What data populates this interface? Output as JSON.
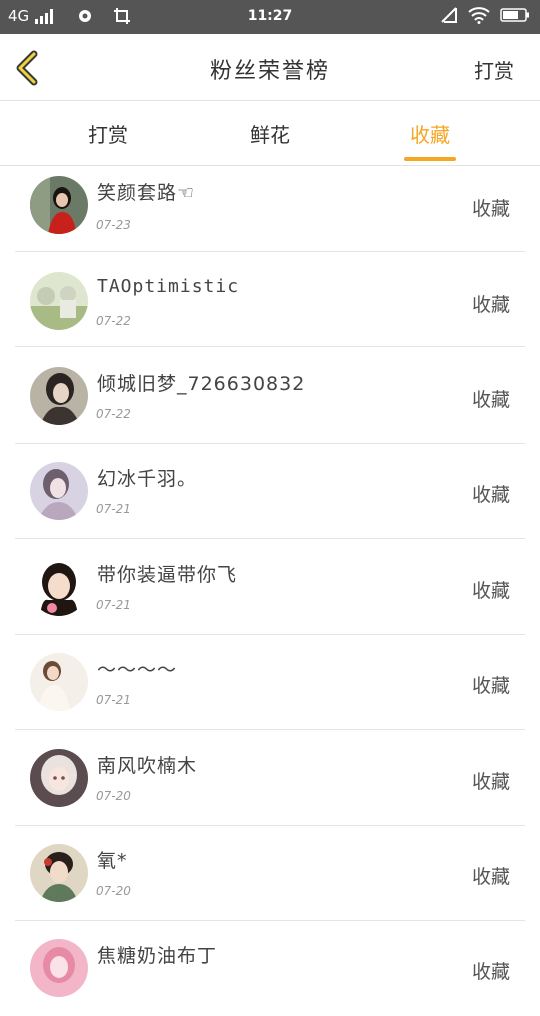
{
  "status_bar": {
    "network": "4G",
    "time": "11:27"
  },
  "nav": {
    "title": "粉丝荣誉榜",
    "action": "打赏"
  },
  "tabs": [
    {
      "label": "打赏",
      "active": false
    },
    {
      "label": "鲜花",
      "active": false
    },
    {
      "label": "收藏",
      "active": true
    }
  ],
  "colors": {
    "accent": "#f5a623",
    "status_bar_bg": "#555555"
  },
  "fans": [
    {
      "name": "笑颜套路☜",
      "date": "07-23",
      "action": "收藏"
    },
    {
      "name": "TAOptimistic",
      "date": "07-22",
      "action": "收藏"
    },
    {
      "name": "倾城旧梦_726630832",
      "date": "07-22",
      "action": "收藏"
    },
    {
      "name": "幻冰千羽。",
      "date": "07-21",
      "action": "收藏"
    },
    {
      "name": "带你装逼带你飞",
      "date": "07-21",
      "action": "收藏"
    },
    {
      "name": "～～～～",
      "date": "07-21",
      "action": "收藏"
    },
    {
      "name": "南风吹楠木",
      "date": "07-20",
      "action": "收藏"
    },
    {
      "name": "氧*",
      "date": "07-20",
      "action": "收藏"
    },
    {
      "name": "焦糖奶油布丁",
      "date": "",
      "action": "收藏"
    }
  ]
}
